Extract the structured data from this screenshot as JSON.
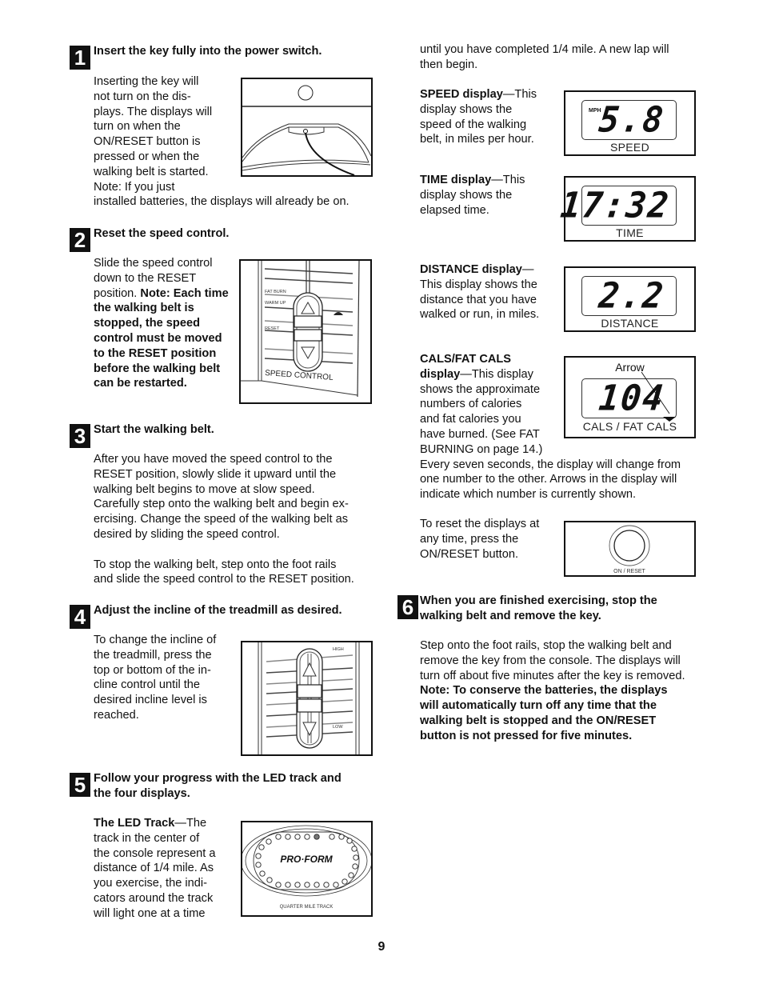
{
  "page_number": "9",
  "steps": [
    {
      "number": "1",
      "title": "Insert the key fully into the power switch.",
      "lines": [
        "Inserting the key will",
        "not turn on the dis-",
        "plays. The displays will",
        "turn on when the",
        "ON/RESET button is",
        "pressed or when the",
        "walking belt is started.",
        "Note: If you just"
      ],
      "last_line": "installed batteries, the displays will already be on."
    },
    {
      "number": "2",
      "title": "Reset the speed control.",
      "text_plain": "Slide the speed control down to the RESET position.",
      "text_bold": "Note: Each time the walking belt is stopped, the speed control must be moved to the RESET position before the walking belt can be restarted.",
      "figure": {
        "labels": [
          "FAT BURN",
          "WARM UP",
          "RESET"
        ],
        "caption": "SPEED CONTROL",
        "icon": "turtle-icon"
      }
    },
    {
      "number": "3",
      "title": "Start the walking belt.",
      "para1_lines": [
        "After you have moved the speed control to the",
        "RESET position, slowly slide it upward until the",
        "walking belt begins to move at slow speed.",
        "Carefully step onto the walking belt and begin ex-",
        "ercising. Change the speed of the walking belt as",
        "desired by sliding the speed control."
      ],
      "para2_lines": [
        "To stop the walking belt, step onto the foot rails",
        "and slide the speed control to the RESET position."
      ]
    },
    {
      "number": "4",
      "title": "Adjust the incline of the treadmill as desired.",
      "lines": [
        "To change the incline of",
        "the treadmill, press the",
        "top or bottom of the in-",
        "cline control until the",
        "desired incline level is",
        "reached."
      ],
      "figure": {
        "label_high": "HIGH",
        "label_low": "LOW"
      }
    },
    {
      "number": "5",
      "title_lines": [
        "Follow your progress with the LED track and",
        "the four displays."
      ],
      "led_track_heading": "The LED Track",
      "led_track_dash": "—The",
      "led_lines": [
        "track in the center of",
        "the console represent a",
        "distance of 1/4 mile. As",
        "you exercise, the indi-",
        "cators around the track",
        "will light one at a time"
      ],
      "figure": {
        "brand": "PRO·FORM",
        "caption": "QUARTER MILE TRACK",
        "lit_indicator_index": 4
      }
    },
    {
      "number": "6",
      "title_lines": [
        "When you are finished exercising, stop the",
        "walking belt and remove the key."
      ],
      "plain_lines": [
        "Step onto the foot rails, stop the walking belt and",
        "remove the key from the console. The displays will",
        "turn off about five minutes after the key is removed."
      ],
      "bold_lines": [
        "Note: To conserve the batteries, the displays",
        "will automatically turn off any time that the",
        "walking belt is stopped and the ON/RESET",
        "button is not pressed for five minutes."
      ]
    }
  ],
  "right_column": {
    "continuation_lines": [
      "until you have completed 1/4 mile. A new lap will",
      "then begin."
    ],
    "speed": {
      "heading": "SPEED display",
      "dash": "—This",
      "lines": [
        "display shows the",
        "speed of the walking",
        "belt, in miles per hour."
      ],
      "unit": "MPH",
      "value": "5.8",
      "label": "SPEED"
    },
    "time": {
      "heading": "TIME display",
      "dash": "—This",
      "lines": [
        "display shows the",
        "elapsed time."
      ],
      "value": "17:32",
      "label": "TIME"
    },
    "distance": {
      "heading": "DISTANCE display",
      "dash": "—",
      "lines": [
        "This display shows the",
        "distance that you have",
        "walked or run, in miles."
      ],
      "value": "2.2",
      "label": "DISTANCE"
    },
    "cals": {
      "heading_line1": "CALS/FAT CALS",
      "heading_line2": "display",
      "dash": "—This display",
      "lines": [
        "shows the approximate",
        "numbers of calories",
        "and fat calories you",
        "have burned. (See FAT",
        "BURNING on page 14.)"
      ],
      "wide_lines": [
        "Every seven seconds, the display will change from",
        "one number to the other. Arrows in the display will",
        "indicate which number is currently shown."
      ],
      "callout": "Arrow",
      "value": "104",
      "label": "CALS / FAT CALS"
    },
    "reset": {
      "lines": [
        "To reset the displays at",
        "any time, press the",
        "ON/RESET button."
      ],
      "label": "ON / RESET"
    }
  }
}
